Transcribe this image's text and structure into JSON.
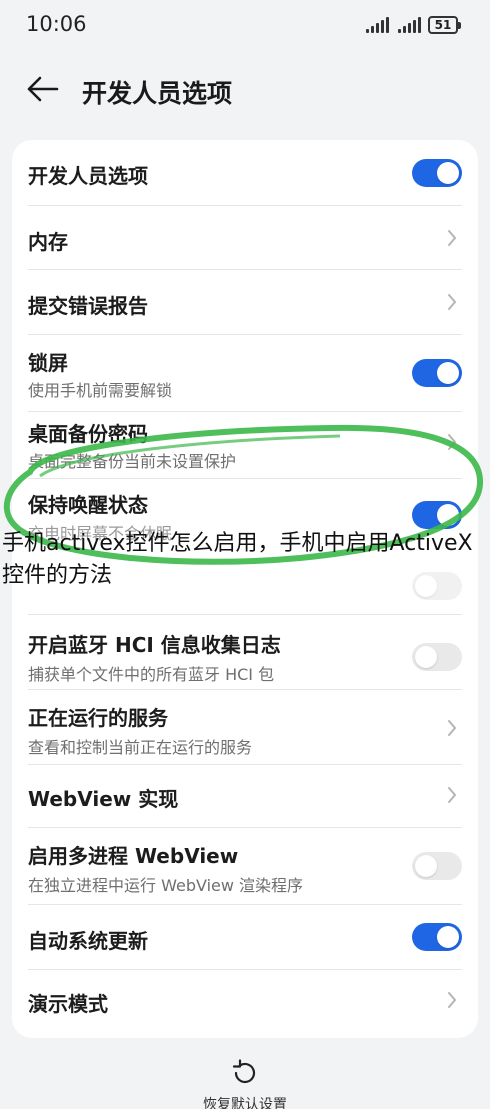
{
  "status_bar": {
    "time": "10:06",
    "battery": "51"
  },
  "header": {
    "title": "开发人员选项"
  },
  "rows": [
    {
      "title": "开发人员选项",
      "toggle": "on"
    },
    {
      "title": "内存",
      "control": "chevron"
    },
    {
      "title": "提交错误报告",
      "control": "chevron"
    },
    {
      "title": "锁屏",
      "subtitle": "使用手机前需要解锁",
      "toggle": "on"
    },
    {
      "title": "桌面备份密码",
      "subtitle": "桌面完整备份当前未设置保护",
      "control": "chevron"
    },
    {
      "title": "保持唤醒状态",
      "subtitle": "充电时屏幕不会休眠",
      "toggle": "on"
    },
    {
      "title": "",
      "toggle": "off"
    },
    {
      "title": "开启蓝牙 HCI 信息收集日志",
      "subtitle": "捕获单个文件中的所有蓝牙 HCI 包",
      "toggle": "off"
    },
    {
      "title": "正在运行的服务",
      "subtitle": "查看和控制当前正在运行的服务",
      "control": "chevron"
    },
    {
      "title": "WebView 实现",
      "control": "chevron"
    },
    {
      "title": "启用多进程 WebView",
      "subtitle": "在独立进程中运行 WebView 渲染程序",
      "toggle": "off"
    },
    {
      "title": "自动系统更新",
      "toggle": "on"
    },
    {
      "title": "演示模式",
      "control": "chevron"
    }
  ],
  "overlay_caption": "手机activex控件怎么启用，手机中启用ActiveX控件的方法",
  "footer": {
    "reset_label": "恢复默认设置"
  },
  "colors": {
    "accent": "#1f66e5",
    "annotation_circle": "#3cb84a",
    "background": "#f1f3f5",
    "card": "#ffffff"
  },
  "icons": [
    "back-arrow-icon",
    "signal-icon",
    "battery-icon",
    "chevron-right-icon",
    "reset-icon"
  ]
}
